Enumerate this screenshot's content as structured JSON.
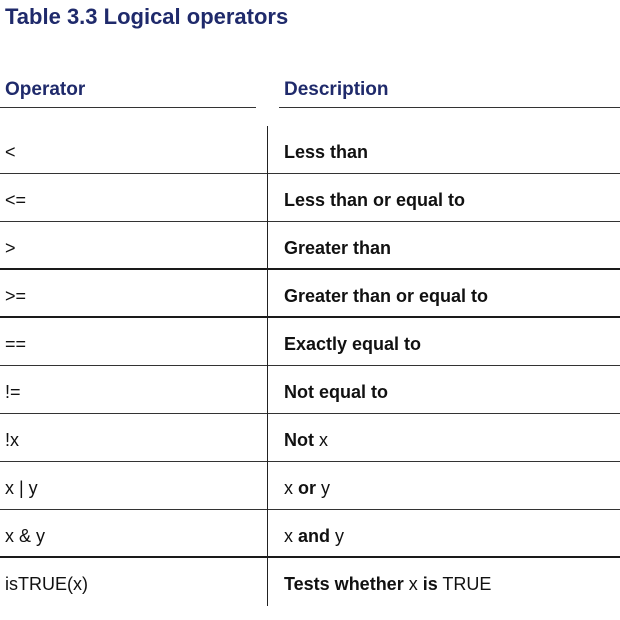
{
  "title": "Table 3.3 Logical operators",
  "headers": {
    "operator": "Operator",
    "description": "Description"
  },
  "rows": [
    {
      "operator": "<",
      "description": [
        {
          "t": "Less than",
          "b": true
        }
      ]
    },
    {
      "operator": "<=",
      "description": [
        {
          "t": "Less than or equal to",
          "b": true
        }
      ]
    },
    {
      "operator": ">",
      "description": [
        {
          "t": "Greater than",
          "b": true
        }
      ]
    },
    {
      "operator": ">=",
      "description": [
        {
          "t": "Greater than or equal to",
          "b": true
        }
      ]
    },
    {
      "operator": "==",
      "description": [
        {
          "t": "Exactly equal to",
          "b": true
        }
      ]
    },
    {
      "operator": "!=",
      "description": [
        {
          "t": "Not equal to",
          "b": true
        }
      ]
    },
    {
      "operator": "!x",
      "description": [
        {
          "t": "Not ",
          "b": true
        },
        {
          "t": "x",
          "b": false
        }
      ]
    },
    {
      "operator": "x | y",
      "description": [
        {
          "t": "x ",
          "b": false
        },
        {
          "t": "or",
          "b": true
        },
        {
          "t": " y",
          "b": false
        }
      ]
    },
    {
      "operator": "x & y",
      "description": [
        {
          "t": "x ",
          "b": false
        },
        {
          "t": "and",
          "b": true
        },
        {
          "t": " y",
          "b": false
        }
      ]
    },
    {
      "operator": "isTRUE(x)",
      "description": [
        {
          "t": "Tests whether ",
          "b": true
        },
        {
          "t": "x ",
          "b": false
        },
        {
          "t": "is",
          "b": true
        },
        {
          "t": " TRUE",
          "b": false
        }
      ]
    }
  ]
}
